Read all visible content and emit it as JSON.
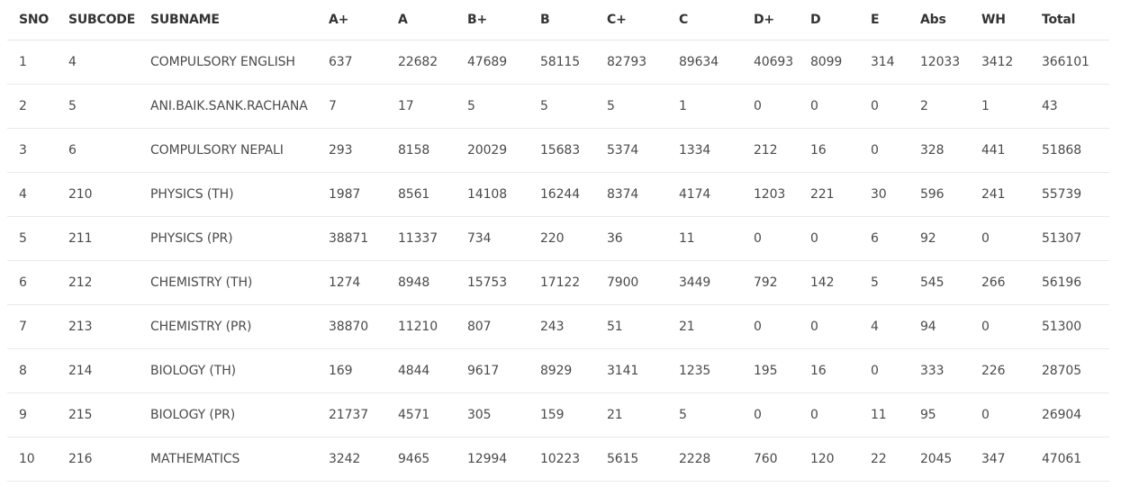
{
  "table": {
    "headers": [
      "SNO",
      "SUBCODE",
      "SUBNAME",
      "A+",
      "A",
      "B+",
      "B",
      "C+",
      "C",
      "D+",
      "D",
      "E",
      "Abs",
      "WH",
      "Total"
    ],
    "rows": [
      [
        "1",
        "4",
        "COMPULSORY ENGLISH",
        "637",
        "22682",
        "47689",
        "58115",
        "82793",
        "89634",
        "40693",
        "8099",
        "314",
        "12033",
        "3412",
        "366101"
      ],
      [
        "2",
        "5",
        "ANI.BAIK.SANK.RACHANA",
        "7",
        "17",
        "5",
        "5",
        "5",
        "1",
        "0",
        "0",
        "0",
        "2",
        "1",
        "43"
      ],
      [
        "3",
        "6",
        "COMPULSORY NEPALI",
        "293",
        "8158",
        "20029",
        "15683",
        "5374",
        "1334",
        "212",
        "16",
        "0",
        "328",
        "441",
        "51868"
      ],
      [
        "4",
        "210",
        "PHYSICS (TH)",
        "1987",
        "8561",
        "14108",
        "16244",
        "8374",
        "4174",
        "1203",
        "221",
        "30",
        "596",
        "241",
        "55739"
      ],
      [
        "5",
        "211",
        "PHYSICS (PR)",
        "38871",
        "11337",
        "734",
        "220",
        "36",
        "11",
        "0",
        "0",
        "6",
        "92",
        "0",
        "51307"
      ],
      [
        "6",
        "212",
        "CHEMISTRY (TH)",
        "1274",
        "8948",
        "15753",
        "17122",
        "7900",
        "3449",
        "792",
        "142",
        "5",
        "545",
        "266",
        "56196"
      ],
      [
        "7",
        "213",
        "CHEMISTRY (PR)",
        "38870",
        "11210",
        "807",
        "243",
        "51",
        "21",
        "0",
        "0",
        "4",
        "94",
        "0",
        "51300"
      ],
      [
        "8",
        "214",
        "BIOLOGY (TH)",
        "169",
        "4844",
        "9617",
        "8929",
        "3141",
        "1235",
        "195",
        "16",
        "0",
        "333",
        "226",
        "28705"
      ],
      [
        "9",
        "215",
        "BIOLOGY (PR)",
        "21737",
        "4571",
        "305",
        "159",
        "21",
        "5",
        "0",
        "0",
        "11",
        "95",
        "0",
        "26904"
      ],
      [
        "10",
        "216",
        "MATHEMATICS",
        "3242",
        "9465",
        "12994",
        "10223",
        "5615",
        "2228",
        "760",
        "120",
        "22",
        "2045",
        "347",
        "47061"
      ]
    ]
  }
}
